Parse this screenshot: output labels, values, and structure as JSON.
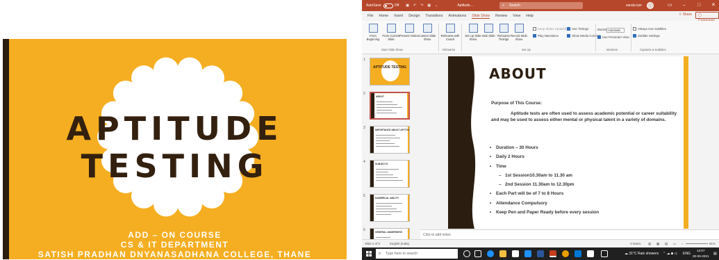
{
  "title_slide": {
    "title_line1": "APTITUDE",
    "title_line2": "TESTING",
    "line1": "ADD – ON COURSE",
    "line2": "CS & IT DEPARTMENT",
    "line3": "SATISH PRADHAN DNYANASADHANA COLLEGE, THANE"
  },
  "window": {
    "autosave": "AutoSave",
    "toggle_state": "Off",
    "filename": "Aptitude...",
    "search_placeholder": "Search",
    "user": "sarala iyer",
    "minimize": "–",
    "maximize": "□",
    "close": "✕"
  },
  "menu": {
    "tabs": [
      "File",
      "Home",
      "Insert",
      "Design",
      "Transitions",
      "Animations",
      "Slide Show",
      "Review",
      "View",
      "Help"
    ],
    "active": "Slide Show",
    "share": "Share",
    "comments": "Comments"
  },
  "ribbon": {
    "from_beginning": "From Beginning",
    "from_current": "From Current Slide",
    "present_online": "Present Online",
    "custom_show": "Custom Slide Show",
    "rehearse_coach": "Rehearse with Coach",
    "setup_show": "Set Up Slide Show",
    "hide_slide": "Hide Slide",
    "rehearse_timings": "Rehearse Timings",
    "record_show": "Record Slide Show",
    "keep_updated": "Keep Slides Updated",
    "use_timings": "Use Timings",
    "play_narrations": "Play Narrations",
    "show_media_controls": "Show Media Controls",
    "monitor_label": "Monitor:",
    "monitor_value": "Automatic",
    "presenter_view": "Use Presenter View",
    "always_subtitles": "Always Use Subtitles",
    "subtitle_settings": "Subtitle Settings",
    "groups": [
      "Start Slide Show",
      "Rehearse",
      "Set Up",
      "Monitors",
      "Captions & Subtitles"
    ]
  },
  "thumbnails": [
    {
      "num": "1",
      "title": "APTITUDE TESTING"
    },
    {
      "num": "2",
      "title": "ABOUT"
    },
    {
      "num": "3",
      "title": "IMPORTANCE ABOUT APTITUDE"
    },
    {
      "num": "4",
      "title": "SUBJECTS"
    },
    {
      "num": "5",
      "title": "NUMERICAL ABILITY"
    },
    {
      "num": "6",
      "title": "GENERAL AWARENESS"
    }
  ],
  "slide": {
    "title": "ABOUT",
    "purpose_label": "Purpose of This Course:",
    "paragraph": "Aptitude tests are often used to assess academic potential or career suitability and may be used to assess either mental or physical talent in a variety of domains.",
    "bullets": [
      {
        "text": "Duration – 30 Hours",
        "sub": false
      },
      {
        "text": "Daily 2 Hours",
        "sub": false
      },
      {
        "text": "Time",
        "sub": false
      },
      {
        "text": "1st Session10.30am to 11.30 am",
        "sub": true
      },
      {
        "text": "2nd Session 11.30am to 12.30pm",
        "sub": true
      },
      {
        "text": "Each Part will be of 7 to 8 Hours",
        "sub": false
      },
      {
        "text": "Attendance Compulsory",
        "sub": false
      },
      {
        "text": "Keep Pen and Paper Ready before every session",
        "sub": false
      }
    ]
  },
  "notes_placeholder": "Click to add notes",
  "status": {
    "slide_count": "Slide 2 of 9",
    "language": "English (India)",
    "notes_btn": "Notes",
    "zoom": "81%"
  },
  "taskbar": {
    "search_placeholder": "Type here to search",
    "weather": "31°C Rain showers",
    "lang": "ENG",
    "time": "13:07",
    "date": "30-06-2021"
  },
  "colors": {
    "accent": "#b7472a",
    "slide_yellow": "#f5ae21",
    "slide_dark": "#2b1e10"
  }
}
